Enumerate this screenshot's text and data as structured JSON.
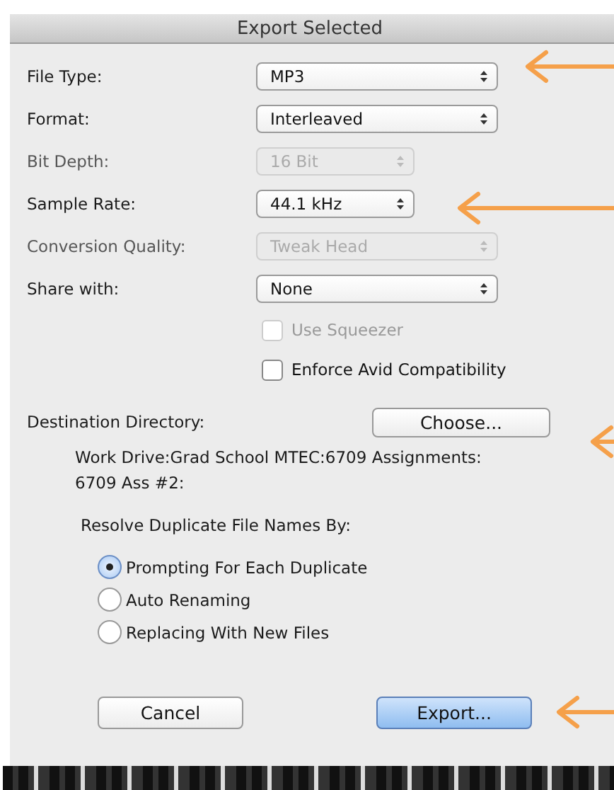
{
  "window": {
    "title": "Export Selected"
  },
  "settings": [
    {
      "kind": "popup",
      "label": "File Type:",
      "value": "MP3",
      "disabled": false,
      "compact": false
    },
    {
      "kind": "popup",
      "label": "Format:",
      "value": "Interleaved",
      "disabled": false,
      "compact": false
    },
    {
      "kind": "popup",
      "label": "Bit Depth:",
      "value": "16 Bit",
      "disabled": true,
      "compact": true
    },
    {
      "kind": "popup",
      "label": "Sample Rate:",
      "value": "44.1 kHz",
      "disabled": false,
      "compact": true
    },
    {
      "kind": "popup",
      "label": "Conversion Quality:",
      "value": "Tweak Head",
      "disabled": true,
      "compact": false
    },
    {
      "kind": "popup",
      "label": "Share with:",
      "value": "None",
      "disabled": false,
      "compact": false
    },
    {
      "kind": "checkbox",
      "label": "Use Squeezer",
      "checked": false,
      "disabled": true
    },
    {
      "kind": "checkbox",
      "label": "Enforce Avid Compatibility",
      "checked": false,
      "disabled": false
    }
  ],
  "destination": {
    "label": "Destination Directory:",
    "button": "Choose...",
    "path": "Work Drive:Grad School MTEC:6709 Assignments:\n6709 Ass #2:"
  },
  "duplicates": {
    "label": "Resolve Duplicate File Names By:",
    "options": [
      {
        "label": "Prompting For Each Duplicate",
        "selected": true
      },
      {
        "label": "Auto Renaming",
        "selected": false
      },
      {
        "label": "Replacing With New Files",
        "selected": false
      }
    ]
  },
  "buttons": [
    {
      "label": "Cancel",
      "default": false
    },
    {
      "label": "Export...",
      "default": true
    }
  ]
}
